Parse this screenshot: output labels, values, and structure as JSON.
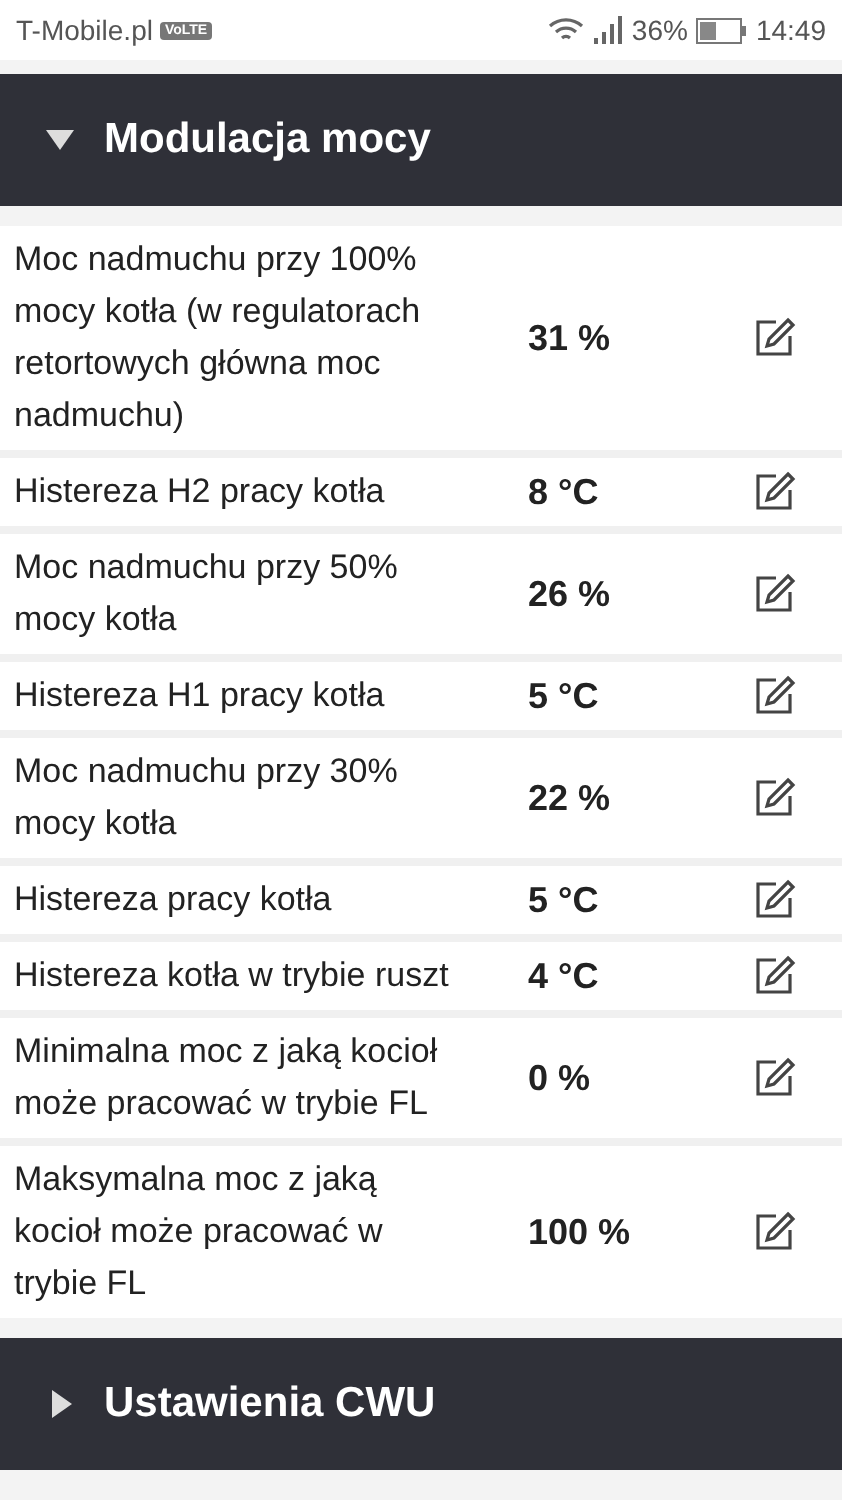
{
  "status_bar": {
    "carrier": "T-Mobile.pl",
    "badge": "VoLTE",
    "battery": "36%",
    "time": "14:49"
  },
  "sections": [
    {
      "title": "Modulacja mocy",
      "expanded": true,
      "rows": [
        {
          "label": "Moc nadmuchu przy 100% mocy kotła (w regulatorach retortowych główna moc nadmuchu)",
          "value": "31 %"
        },
        {
          "label": "Histereza H2 pracy kotła",
          "value": "8 °C"
        },
        {
          "label": "Moc nadmuchu przy 50% mocy kotła",
          "value": "26 %"
        },
        {
          "label": "Histereza H1 pracy kotła",
          "value": "5 °C"
        },
        {
          "label": "Moc nadmuchu przy 30% mocy kotła",
          "value": "22 %"
        },
        {
          "label": "Histereza pracy kotła",
          "value": "5 °C"
        },
        {
          "label": "Histereza kotła w trybie ruszt",
          "value": "4 °C"
        },
        {
          "label": "Minimalna moc z jaką kocioł może pracować w trybie FL",
          "value": "0 %"
        },
        {
          "label": "Maksymalna moc z jaką kocioł może pracować w trybie FL",
          "value": "100 %"
        }
      ]
    },
    {
      "title": "Ustawienia CWU",
      "expanded": false
    }
  ]
}
